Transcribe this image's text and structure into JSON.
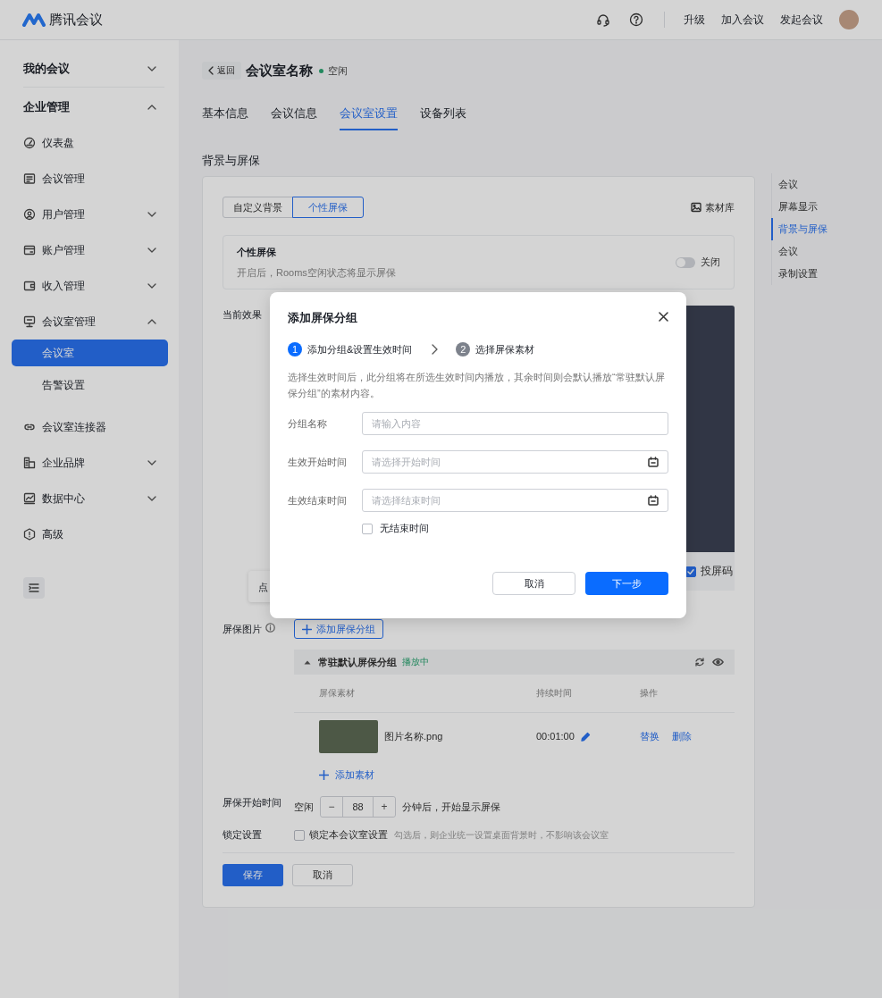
{
  "header": {
    "brand": "腾讯会议",
    "links": [
      "升级",
      "加入会议",
      "发起会议"
    ]
  },
  "sidebar": {
    "items": [
      {
        "label": "我的会议",
        "kind": "group",
        "expanded": false,
        "selected": false
      },
      {
        "label": "企业管理",
        "kind": "group",
        "expanded": true,
        "selected": false,
        "children": [
          {
            "label": "仪表盘",
            "kind": "link",
            "selected": false
          },
          {
            "label": "会议管理",
            "kind": "link",
            "selected": false
          },
          {
            "label": "用户管理",
            "kind": "group",
            "expanded": false,
            "selected": false
          },
          {
            "label": "账户管理",
            "kind": "group",
            "expanded": false,
            "selected": false
          },
          {
            "label": "收入管理",
            "kind": "group",
            "expanded": false,
            "selected": false
          },
          {
            "label": "会议室管理",
            "kind": "group",
            "expanded": true,
            "selected": false,
            "children": [
              {
                "label": "会议室",
                "selected": true
              },
              {
                "label": "告警设置",
                "selected": false
              }
            ]
          },
          {
            "label": "会议室连接器",
            "kind": "link",
            "selected": false
          },
          {
            "label": "企业品牌",
            "kind": "group",
            "expanded": false,
            "selected": false
          },
          {
            "label": "数据中心",
            "kind": "group",
            "expanded": false,
            "selected": false
          },
          {
            "label": "高级",
            "kind": "link",
            "selected": false
          }
        ]
      }
    ]
  },
  "page": {
    "back": "返回",
    "title": "会议室名称",
    "status": "空闲"
  },
  "tabs": [
    {
      "label": "基本信息",
      "selected": false
    },
    {
      "label": "会议信息",
      "selected": false
    },
    {
      "label": "会议室设置",
      "selected": true
    },
    {
      "label": "设备列表",
      "selected": false
    }
  ],
  "section_title": "背景与屏保",
  "anchors": [
    {
      "label": "会议",
      "selected": false
    },
    {
      "label": "屏幕显示",
      "selected": false
    },
    {
      "label": "背景与屏保",
      "selected": true
    },
    {
      "label": "会议",
      "selected": false
    },
    {
      "label": "录制设置",
      "selected": false
    }
  ],
  "panel": {
    "modes": [
      {
        "label": "自定义背景",
        "selected": false
      },
      {
        "label": "个性屏保",
        "selected": true
      }
    ],
    "library": "素材库",
    "toggle_card": {
      "title": "个性屏保",
      "description": "开启后，Rooms空闲状态将显示屏保",
      "on": false,
      "state_text": "关闭"
    },
    "preview": {
      "label": "当前效果",
      "tip": "点",
      "qr_code": {
        "label": "投屏码",
        "checked": true
      }
    },
    "images": {
      "label": "屏保图片",
      "add_group": "添加屏保分组",
      "group": {
        "title": "常驻默认屏保分组",
        "status": "播放中",
        "expanded": true
      },
      "columns": [
        "屏保素材",
        "持续时间",
        "操作"
      ],
      "rows": [
        {
          "name": "图片名称.png",
          "duration": "00:01:00",
          "actions": [
            "替换",
            "删除"
          ]
        }
      ],
      "add_item": "添加素材"
    },
    "start": {
      "label": "屏保开始时间",
      "prefix": "空闲",
      "minus": "−",
      "value": "88",
      "plus": "+",
      "suffix": "分钟后，开始显示屏保"
    },
    "lock": {
      "label": "锁定设置",
      "checkbox": "锁定本会议室设置",
      "checked": false,
      "hint": "勾选后，则企业统一设置桌面背景时，不影响该会议室"
    },
    "buttons": [
      {
        "label": "保存",
        "kind": "primary"
      },
      {
        "label": "取消",
        "kind": "default"
      }
    ]
  },
  "dialog": {
    "title": "添加屏保分组",
    "steps": [
      {
        "number": "1",
        "label": "添加分组&设置生效时间",
        "selected": true
      },
      {
        "number": "2",
        "label": "选择屏保素材",
        "selected": false
      }
    ],
    "description": "选择生效时间后，此分组将在所选生效时间内播放，其余时间则会默认播放“常驻默认屏保分组”的素材内容。",
    "fields": [
      {
        "label": "分组名称",
        "placeholder": "请输入内容",
        "kind": "text"
      },
      {
        "label": "生效开始时间",
        "placeholder": "请选择开始时间",
        "kind": "date"
      },
      {
        "label": "生效结束时间",
        "placeholder": "请选择结束时间",
        "kind": "date"
      }
    ],
    "no_end": {
      "label": "无结束时间",
      "checked": false
    },
    "buttons": [
      {
        "label": "取消",
        "kind": "default"
      },
      {
        "label": "下一步",
        "kind": "primary"
      }
    ]
  }
}
